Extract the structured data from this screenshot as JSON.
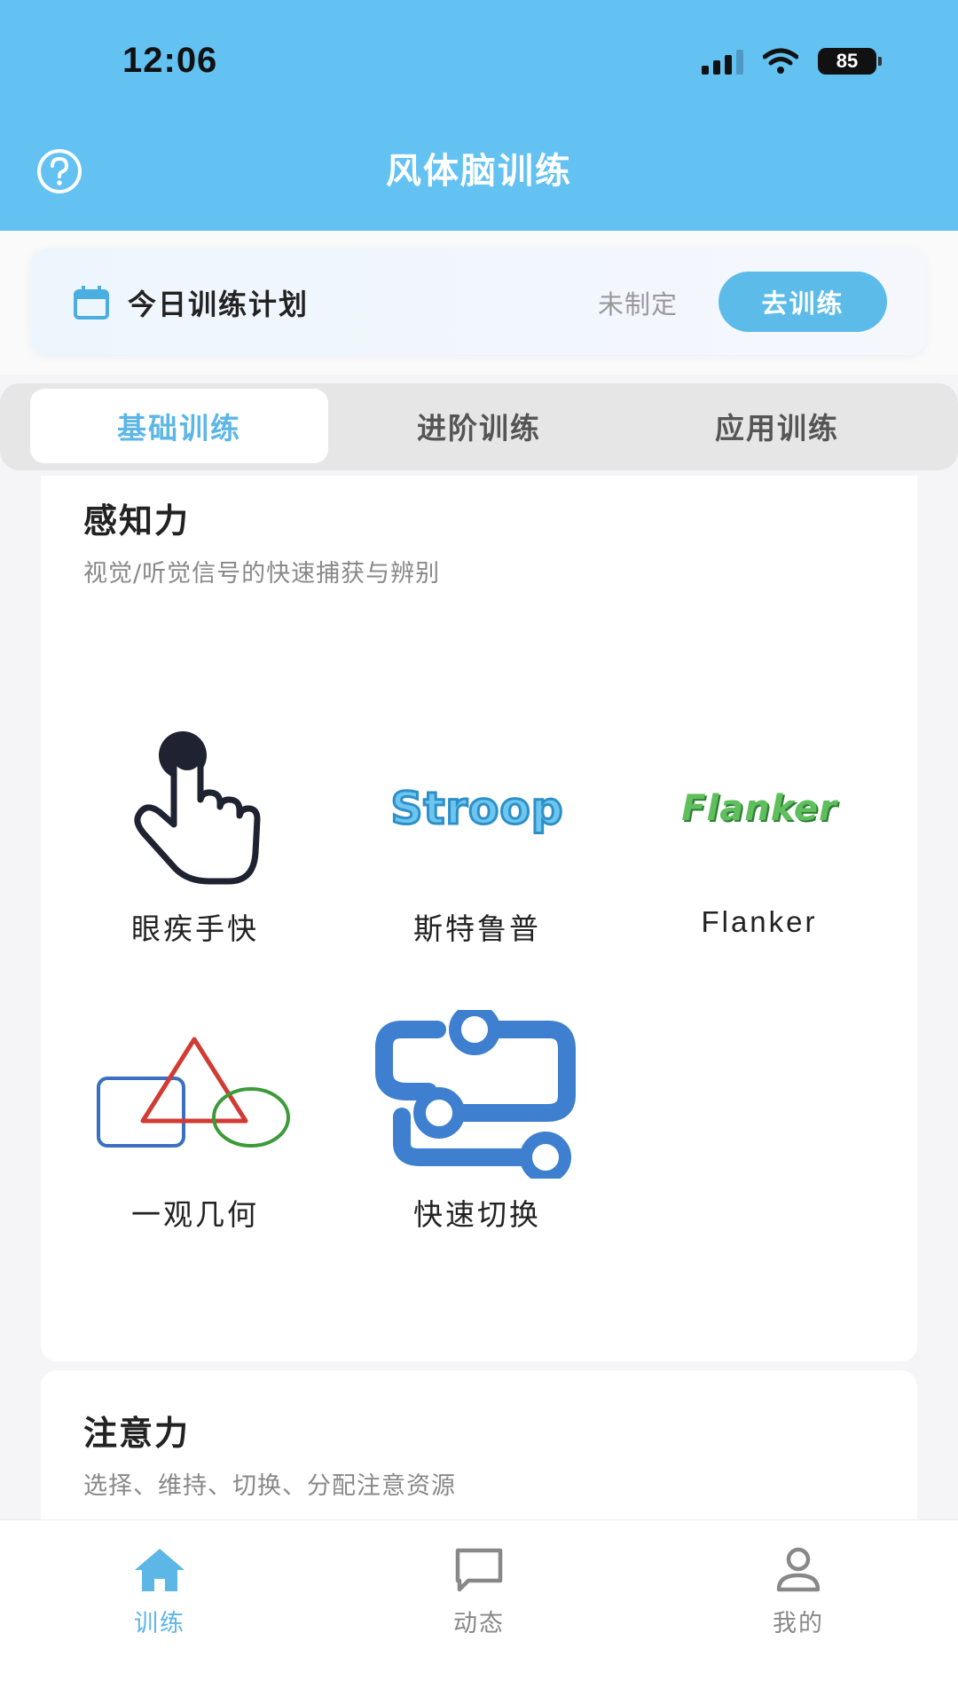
{
  "status_bar": {
    "time": "12:06",
    "battery": "85"
  },
  "header": {
    "title": "风体脑训练"
  },
  "plan": {
    "label": "今日训练计划",
    "status": "未制定",
    "button": "去训练"
  },
  "tabs": [
    {
      "label": "基础训练",
      "active": true
    },
    {
      "label": "进阶训练",
      "active": false
    },
    {
      "label": "应用训练",
      "active": false
    }
  ],
  "categories": [
    {
      "title": "感知力",
      "subtitle": "视觉/听觉信号的快速捕获与辨别",
      "items": [
        {
          "label": "眼疾手快",
          "icon": "tap-hand-icon"
        },
        {
          "label": "斯特鲁普",
          "icon": "stroop-logo",
          "logo_text": "Stroop"
        },
        {
          "label": "Flanker",
          "icon": "flanker-logo",
          "logo_text": "Flanker"
        },
        {
          "label": "一观几何",
          "icon": "geometry-shapes-icon"
        },
        {
          "label": "快速切换",
          "icon": "switch-path-icon"
        }
      ]
    },
    {
      "title": "注意力",
      "subtitle": "选择、维持、切换、分配注意资源"
    }
  ],
  "bottom_nav": [
    {
      "label": "训练",
      "icon": "home-icon",
      "active": true
    },
    {
      "label": "动态",
      "icon": "chat-icon",
      "active": false
    },
    {
      "label": "我的",
      "icon": "user-icon",
      "active": false
    }
  ],
  "colors": {
    "header": "#63c2f2",
    "accent": "#5cb6e6",
    "button": "#5cbbe8"
  }
}
